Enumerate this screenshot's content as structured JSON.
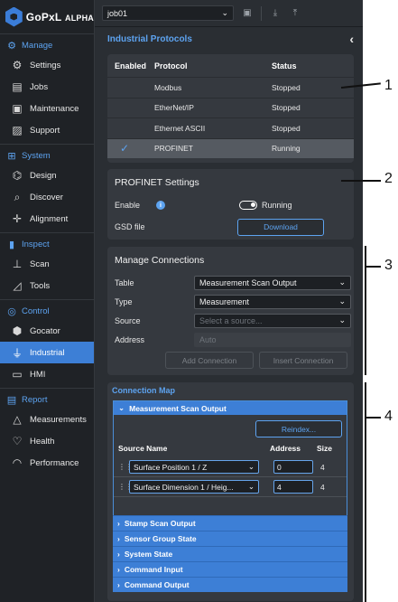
{
  "brand": {
    "name": "GoPxL",
    "edition": "ALPHA"
  },
  "sidebar": {
    "sections": [
      {
        "title": "Manage",
        "icon": "gears-icon",
        "items": [
          {
            "label": "Settings",
            "icon": "gear-icon"
          },
          {
            "label": "Jobs",
            "icon": "jobs-icon"
          },
          {
            "label": "Maintenance",
            "icon": "toolbox-icon"
          },
          {
            "label": "Support",
            "icon": "support-icon"
          }
        ]
      },
      {
        "title": "System",
        "icon": "network-icon",
        "items": [
          {
            "label": "Design",
            "icon": "design-icon"
          },
          {
            "label": "Discover",
            "icon": "discover-icon"
          },
          {
            "label": "Alignment",
            "icon": "alignment-icon"
          }
        ]
      },
      {
        "title": "Inspect",
        "icon": "inspect-icon",
        "items": [
          {
            "label": "Scan",
            "icon": "scan-icon"
          },
          {
            "label": "Tools",
            "icon": "tools-icon"
          }
        ]
      },
      {
        "title": "Control",
        "icon": "control-icon",
        "items": [
          {
            "label": "Gocator",
            "icon": "gocator-icon"
          },
          {
            "label": "Industrial",
            "icon": "plug-icon",
            "active": true
          },
          {
            "label": "HMI",
            "icon": "hmi-icon"
          }
        ]
      },
      {
        "title": "Report",
        "icon": "report-icon",
        "items": [
          {
            "label": "Measurements",
            "icon": "measurements-icon"
          },
          {
            "label": "Health",
            "icon": "health-icon"
          },
          {
            "label": "Performance",
            "icon": "performance-icon"
          }
        ]
      }
    ]
  },
  "toolbar": {
    "job": "job01"
  },
  "panel": {
    "title": "Industrial Protocols"
  },
  "protocols": {
    "headers": {
      "enabled": "Enabled",
      "protocol": "Protocol",
      "status": "Status"
    },
    "rows": [
      {
        "name": "Modbus",
        "status": "Stopped",
        "enabled": false
      },
      {
        "name": "EtherNet/IP",
        "status": "Stopped",
        "enabled": false
      },
      {
        "name": "Ethernet ASCII",
        "status": "Stopped",
        "enabled": false
      },
      {
        "name": "PROFINET",
        "status": "Running",
        "enabled": true
      }
    ]
  },
  "profinet": {
    "title": "PROFINET Settings",
    "enable_label": "Enable",
    "running_label": "Running",
    "gsd_label": "GSD file",
    "download_label": "Download"
  },
  "manage": {
    "title": "Manage Connections",
    "table_label": "Table",
    "table_value": "Measurement Scan Output",
    "type_label": "Type",
    "type_value": "Measurement",
    "source_label": "Source",
    "source_placeholder": "Select a source...",
    "address_label": "Address",
    "address_placeholder": "Auto",
    "add_label": "Add Connection",
    "insert_label": "Insert Connection"
  },
  "map": {
    "title": "Connection Map",
    "open_group": "Measurement Scan Output",
    "reindex_label": "Reindex...",
    "col_source": "Source Name",
    "col_address": "Address",
    "col_size": "Size",
    "rows": [
      {
        "source": "Surface Position 1 / Z",
        "address": "0",
        "size": "4"
      },
      {
        "source": "Surface Dimension 1 / Heig...",
        "address": "4",
        "size": "4"
      }
    ],
    "groups": [
      "Stamp Scan Output",
      "Sensor Group State",
      "System State",
      "Command Input",
      "Command Output"
    ]
  },
  "annotations": [
    "1",
    "2",
    "3",
    "4"
  ]
}
